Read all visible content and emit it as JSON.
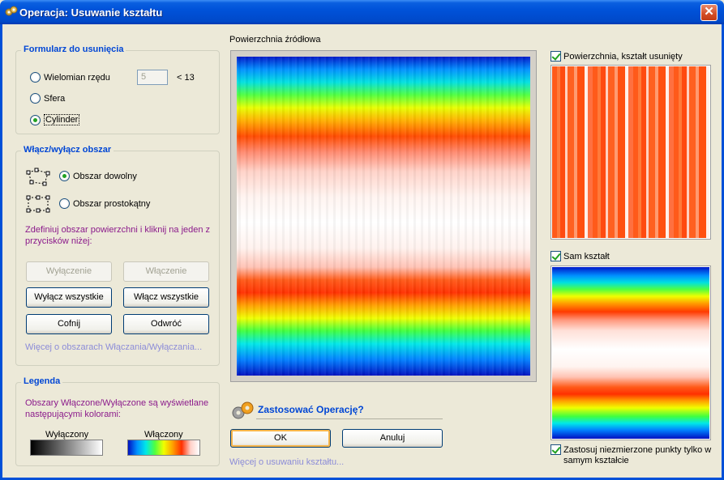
{
  "window": {
    "title": "Operacja: Usuwanie kształtu",
    "close_glyph": "✕",
    "icon": "gears-icon"
  },
  "form_group": {
    "title": "Formularz do usunięcia",
    "options": [
      {
        "label": "Wielomian rzędu",
        "selected": false
      },
      {
        "label": "Sfera",
        "selected": false
      },
      {
        "label": "Cylinder",
        "selected": true
      }
    ],
    "polynomial_value": "5",
    "polynomial_limit": "< 13"
  },
  "region_group": {
    "title": "Włącz/wyłącz obszar",
    "options": [
      {
        "label": "Obszar dowolny",
        "selected": true,
        "icon": "freeform-region-icon"
      },
      {
        "label": "Obszar prostokątny",
        "selected": false,
        "icon": "rectangle-region-icon"
      }
    ],
    "instructions": "Zdefiniuj obszar powierzchni i kliknij na jeden z przycisków niżej:",
    "buttons": {
      "exclude": "Wyłączenie",
      "include": "Włączenie",
      "exclude_all": "Wyłącz wszystkie",
      "include_all": "Włącz wszystkie",
      "undo": "Cofnij",
      "invert": "Odwróć"
    },
    "more_link": "Więcej o obszarach Włączania/Wyłączania..."
  },
  "legend_group": {
    "title": "Legenda",
    "text": "Obszary Włączone/Wyłączone są wyświetlane następującymi kolorami:",
    "excluded_label": "Wyłączony",
    "included_label": "Włączony"
  },
  "source": {
    "label": "Powierzchnia źródłowa"
  },
  "apply": {
    "label": "Zastosować Operację?",
    "ok": "OK",
    "cancel": "Anuluj",
    "more_link": "Więcej o usuwaniu kształtu..."
  },
  "right_panel": {
    "surface_removed": {
      "label": "Powierzchnia, kształt usunięty",
      "checked": true
    },
    "shape_only": {
      "label": "Sam kształt",
      "checked": true
    },
    "apply_unmeasured": {
      "label": "Zastosuj niezmierzone punkty tylko w samym kształcie",
      "checked": true
    }
  },
  "colors": {
    "group_title": "#0046d5",
    "instructions": "#8b1a8b",
    "link": "#8c8cd8",
    "dialog_bg": "#ece9d8"
  }
}
